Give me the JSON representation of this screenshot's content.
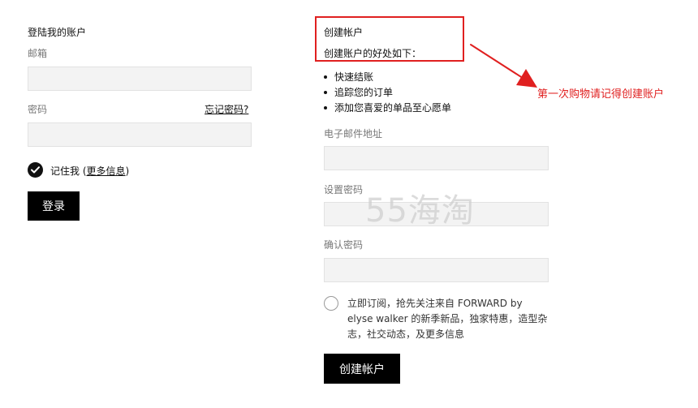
{
  "login": {
    "title": "登陆我的账户",
    "email_label": "邮箱",
    "email_value": "",
    "password_label": "密码",
    "password_value": "",
    "forgot_password": "忘记密码?",
    "remember_me": {
      "checked": true,
      "label_prefix": "记住我 (",
      "more_info": "更多信息",
      "label_suffix": ")"
    },
    "submit_label": "登录"
  },
  "create_account": {
    "title": "创建帐户",
    "benefits_intro": "创建账户的好处如下：",
    "benefits": [
      "快速结账",
      "追踪您的订单",
      "添加您喜爱的单品至心愿单"
    ],
    "email_label": "电子邮件地址",
    "email_value": "",
    "password_label": "设置密码",
    "password_value": "",
    "confirm_label": "确认密码",
    "confirm_value": "",
    "subscribe": {
      "checked": false,
      "text": "立即订阅，抢先关注来自 FORWARD by elyse walker 的新季新品，独家特惠，造型杂志，社交动态，及更多信息"
    },
    "submit_label": "创建帐户"
  },
  "annotation": {
    "text": "第一次购物请记得创建账户",
    "color": "#e02020"
  },
  "watermark": {
    "text": "55海淘"
  },
  "colors": {
    "button_bg": "#000000",
    "input_bg": "#f3f3f3",
    "annotation_red": "#e02020"
  }
}
